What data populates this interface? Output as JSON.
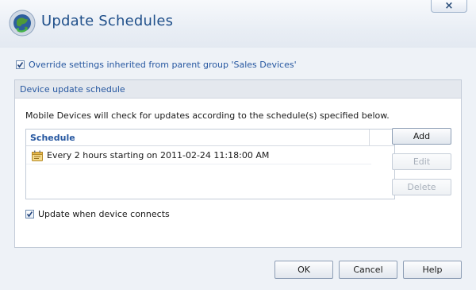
{
  "dialog": {
    "title": "Update Schedules",
    "close_glyph": "×"
  },
  "override": {
    "checked": true,
    "label": "Override settings inherited from parent group 'Sales Devices'"
  },
  "group": {
    "title": "Device update schedule",
    "description": "Mobile Devices will check for updates according to the schedule(s) specified below.",
    "list": {
      "column_header": "Schedule",
      "rows": [
        {
          "icon": "schedule-note-icon",
          "text": "Every 2 hours starting on 2011-02-24 11:18:00 AM"
        }
      ]
    },
    "buttons": {
      "add": "Add",
      "edit": "Edit",
      "delete": "Delete"
    },
    "connect": {
      "checked": true,
      "label": "Update when device connects"
    }
  },
  "footer": {
    "ok": "OK",
    "cancel": "Cancel",
    "help": "Help"
  },
  "colors": {
    "title_blue": "#1f4f8a",
    "link_blue": "#2657a0",
    "background": "#eef2f7"
  }
}
